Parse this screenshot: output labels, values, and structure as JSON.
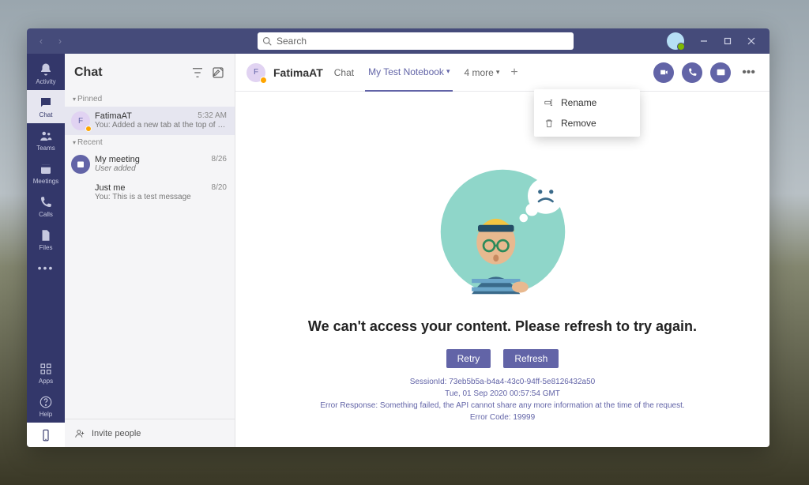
{
  "titlebar": {
    "search_placeholder": "Search"
  },
  "rail": {
    "items": [
      {
        "label": "Activity",
        "icon": "bell"
      },
      {
        "label": "Chat",
        "icon": "chat",
        "active": true
      },
      {
        "label": "Teams",
        "icon": "teams"
      },
      {
        "label": "Meetings",
        "icon": "calendar"
      },
      {
        "label": "Calls",
        "icon": "phone"
      },
      {
        "label": "Files",
        "icon": "files"
      }
    ],
    "more": "•••",
    "apps": "Apps",
    "help": "Help"
  },
  "chatlist": {
    "title": "Chat",
    "sections": {
      "pinned": "Pinned",
      "recent": "Recent"
    },
    "items": [
      {
        "name": "FatimaAT",
        "time": "5:32 AM",
        "preview": "You: Added a new tab at the top of this…",
        "initials": "F",
        "status": "#ffa500",
        "selected": true
      },
      {
        "name": "My meeting",
        "time": "8/26",
        "preview": "User added",
        "initials": "",
        "bg": "#6264a7",
        "status": "",
        "selected": false
      },
      {
        "name": "Just me",
        "time": "8/20",
        "preview": "You: This is a test message",
        "initials": "",
        "bg": "transparent",
        "status": "",
        "selected": false
      }
    ],
    "invite": "Invite people"
  },
  "main": {
    "person": {
      "name": "FatimaAT",
      "initials": "F",
      "status": "#ffa500"
    },
    "tabs": {
      "chat": "Chat",
      "notebook": "My Test Notebook",
      "more": "4 more"
    }
  },
  "context_menu": {
    "rename": "Rename",
    "remove": "Remove"
  },
  "error": {
    "title": "We can't access your content. Please refresh to try again.",
    "retry": "Retry",
    "refresh": "Refresh",
    "session": "SessionId: 73eb5b5a-b4a4-43c0-94ff-5e8126432a50",
    "time": "Tue, 01 Sep 2020 00:57:54 GMT",
    "response": "Error Response: Something failed, the API cannot share any more information at the time of the request.",
    "code": "Error Code: 19999"
  }
}
